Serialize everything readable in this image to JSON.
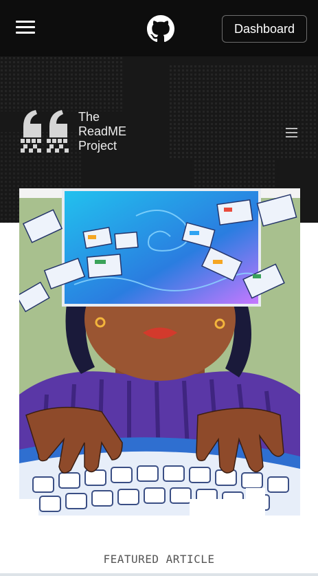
{
  "nav": {
    "dashboard_label": "Dashboard",
    "menu_icon": "hamburger-icon",
    "logo_icon": "github-icon"
  },
  "hero": {
    "brand_lines": [
      "The",
      "ReadME",
      "Project"
    ],
    "menu_icon": "menu-icon",
    "background": "#1b1b1b"
  },
  "featured": {
    "label": "FEATURED ARTICLE"
  },
  "colors": {
    "topnav": "#0d0d0d",
    "hero": "#1b1b1b",
    "accent_purple": "#5b3aa8",
    "screen_blue": "#2ea3f2"
  }
}
